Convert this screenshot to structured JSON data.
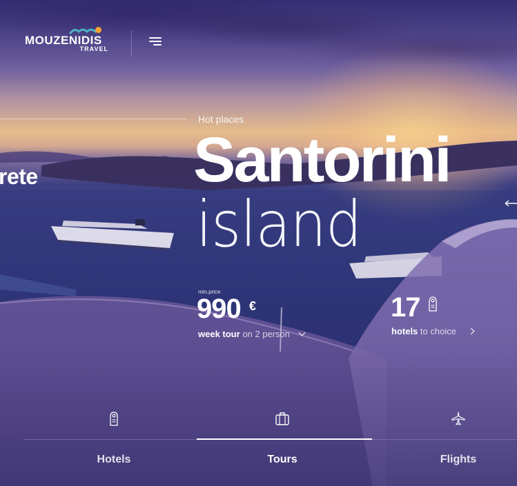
{
  "brand": {
    "name": "MOUZENIDIS",
    "sub": "TRAVEL",
    "accent": "#f2a531"
  },
  "header": {
    "menu_icon": "hamburger-menu-icon"
  },
  "hero": {
    "prev_slide": "rete",
    "eyebrow": "Hot places",
    "title": "Santorini",
    "subtitle": "island"
  },
  "price": {
    "label": "min.price",
    "value": "990",
    "currency": "€",
    "detail_bold": "week tour",
    "detail_light": "on 2 person"
  },
  "hotels": {
    "count": "17",
    "detail_bold": "hotels",
    "detail_light": "to choice",
    "icon": "door-hanger-icon"
  },
  "nav": {
    "tabs": [
      {
        "label": "Hotels",
        "icon": "door-hanger-icon",
        "active": false
      },
      {
        "label": "Tours",
        "icon": "suitcase-icon",
        "active": true
      },
      {
        "label": "Flights",
        "icon": "airplane-icon",
        "active": false
      }
    ]
  }
}
